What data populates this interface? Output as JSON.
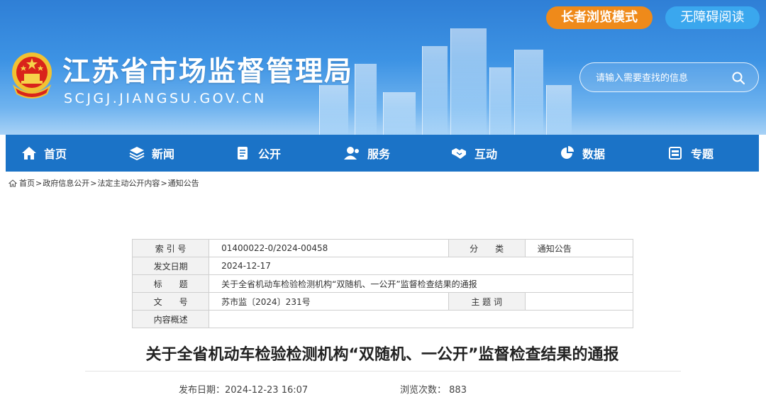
{
  "header": {
    "site_title": "江苏省市场监督管理局",
    "site_domain": "SCJGJ.JIANGSU.GOV.CN",
    "elder_mode_label": "长者浏览模式",
    "accessibility_label": "无障碍阅读",
    "search_placeholder": "请输入需要查找的信息",
    "emblem_icon": "national-emblem-icon"
  },
  "nav": {
    "items": [
      {
        "label": "首页",
        "icon": "home-icon"
      },
      {
        "label": "新闻",
        "icon": "layers-icon"
      },
      {
        "label": "公开",
        "icon": "document-icon"
      },
      {
        "label": "服务",
        "icon": "user-icon"
      },
      {
        "label": "互动",
        "icon": "handshake-icon"
      },
      {
        "label": "数据",
        "icon": "pie-chart-icon"
      },
      {
        "label": "专题",
        "icon": "topic-icon"
      }
    ]
  },
  "breadcrumb": [
    "首页",
    "政府信息公开",
    "法定主动公开内容",
    "通知公告"
  ],
  "breadcrumb_sep": ">",
  "meta": {
    "index_label": "索 引 号",
    "index_value": "01400022-0/2024-00458",
    "category_label": "分　　类",
    "category_value": "通知公告",
    "date_label": "发文日期",
    "date_value": "2024-12-17",
    "title_label": "标　　题",
    "title_value": "关于全省机动车检验检测机构“双随机、一公开”监督检查结果的通报",
    "docno_label": "文　　号",
    "docno_value": "苏市监〔2024〕231号",
    "subject_label": "主 题 词",
    "subject_value": "",
    "summary_label": "内容概述",
    "summary_value": ""
  },
  "article": {
    "title": "关于全省机动车检验检测机构“双随机、一公开”监督检查结果的通报",
    "publish_label": "发布日期：",
    "publish_value": "2024-12-23 16:07",
    "views_label": "浏览次数：",
    "views_value": "883"
  },
  "colors": {
    "header_blue": "#2f7fd6",
    "nav_blue": "#1b73c7",
    "elder_orange": "#ef8a1a",
    "access_blue": "#3aa7ee"
  }
}
